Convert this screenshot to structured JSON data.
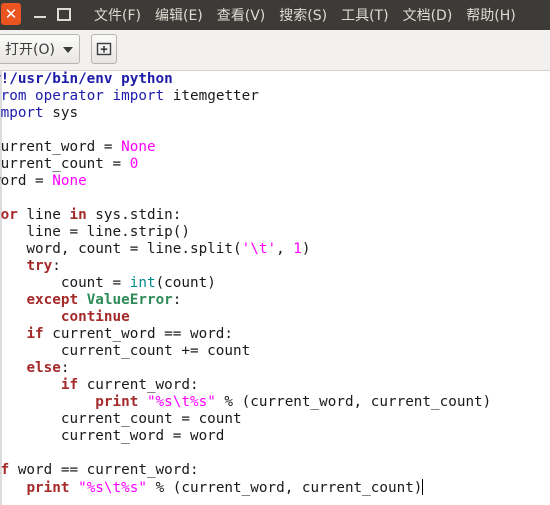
{
  "window": {
    "close_glyph": "✕"
  },
  "menu": [
    "文件(F)",
    "编辑(E)",
    "查看(V)",
    "搜索(S)",
    "工具(T)",
    "文档(D)",
    "帮助(H)"
  ],
  "toolbar": {
    "open_label": "打开(O)"
  },
  "icons": {
    "close": "close-icon",
    "minimize": "minimize-icon",
    "maximize": "maximize-icon",
    "open_dropdown": "chevron-down-icon",
    "new_tab": "new-tab-icon"
  },
  "code_lines": [
    [
      [
        "sb",
        "#!/usr/bin/env python"
      ]
    ],
    [
      [
        "pre",
        "from"
      ],
      [
        "n",
        " "
      ],
      [
        "pre",
        "operator"
      ],
      [
        "n",
        " "
      ],
      [
        "pre",
        "import"
      ],
      [
        "n",
        " itemgetter"
      ]
    ],
    [
      [
        "pre",
        "import"
      ],
      [
        "n",
        " sys"
      ]
    ],
    [
      [
        "n",
        ""
      ]
    ],
    [
      [
        "n",
        "current_word = "
      ],
      [
        "cn",
        "None"
      ]
    ],
    [
      [
        "n",
        "current_count = "
      ],
      [
        "cn",
        "0"
      ]
    ],
    [
      [
        "n",
        "word = "
      ],
      [
        "cn",
        "None"
      ]
    ],
    [
      [
        "n",
        ""
      ]
    ],
    [
      [
        "kw",
        "for"
      ],
      [
        "n",
        " line "
      ],
      [
        "kw",
        "in"
      ],
      [
        "n",
        " sys.stdin:"
      ]
    ],
    [
      [
        "n",
        "    line = line.strip()"
      ]
    ],
    [
      [
        "n",
        "    word, count = line.split("
      ],
      [
        "st",
        "'\\t'"
      ],
      [
        "n",
        ", "
      ],
      [
        "cn",
        "1"
      ],
      [
        "n",
        ")"
      ]
    ],
    [
      [
        "n",
        "    "
      ],
      [
        "kw",
        "try"
      ],
      [
        "n",
        ":"
      ]
    ],
    [
      [
        "n",
        "        count = "
      ],
      [
        "bi",
        "int"
      ],
      [
        "n",
        "(count)"
      ]
    ],
    [
      [
        "n",
        "    "
      ],
      [
        "kw",
        "except"
      ],
      [
        "n",
        " "
      ],
      [
        "ty",
        "ValueError"
      ],
      [
        "n",
        ":"
      ]
    ],
    [
      [
        "n",
        "        "
      ],
      [
        "kw",
        "continue"
      ]
    ],
    [
      [
        "n",
        "    "
      ],
      [
        "kw",
        "if"
      ],
      [
        "n",
        " current_word == word:"
      ]
    ],
    [
      [
        "n",
        "        current_count += count"
      ]
    ],
    [
      [
        "n",
        "    "
      ],
      [
        "kw",
        "else"
      ],
      [
        "n",
        ":"
      ]
    ],
    [
      [
        "n",
        "        "
      ],
      [
        "kw",
        "if"
      ],
      [
        "n",
        " current_word:"
      ]
    ],
    [
      [
        "n",
        "            "
      ],
      [
        "kw",
        "print"
      ],
      [
        "n",
        " "
      ],
      [
        "st",
        "\"%s\\t%s\""
      ],
      [
        "n",
        " % (current_word, current_count)"
      ]
    ],
    [
      [
        "n",
        "        current_count = count"
      ]
    ],
    [
      [
        "n",
        "        current_word = word"
      ]
    ],
    [
      [
        "n",
        ""
      ]
    ],
    [
      [
        "kw",
        "if"
      ],
      [
        "n",
        " word == current_word:"
      ]
    ],
    [
      [
        "n",
        "    "
      ],
      [
        "kw",
        "print"
      ],
      [
        "n",
        " "
      ],
      [
        "st",
        "\"%s\\t%s\""
      ],
      [
        "n",
        " % (current_word, current_count)"
      ],
      [
        "cursor",
        ""
      ]
    ]
  ]
}
